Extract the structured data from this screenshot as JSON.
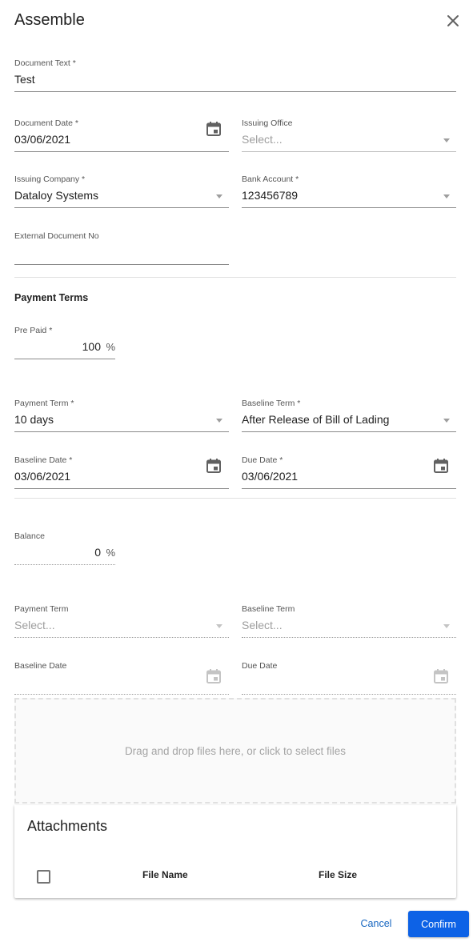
{
  "dialog": {
    "title": "Assemble"
  },
  "fields": {
    "document_text": {
      "label": "Document Text *",
      "value": "Test"
    },
    "document_date": {
      "label": "Document Date *",
      "value": "03/06/2021"
    },
    "issuing_office": {
      "label": "Issuing Office",
      "placeholder": "Select..."
    },
    "issuing_company": {
      "label": "Issuing Company *",
      "value": "Dataloy Systems"
    },
    "bank_account": {
      "label": "Bank Account *",
      "value": "123456789"
    },
    "external_document_no": {
      "label": "External Document No",
      "value": ""
    }
  },
  "payment_terms": {
    "heading": "Payment Terms",
    "pre_paid": {
      "label": "Pre Paid *",
      "value": "100",
      "unit": "%"
    },
    "payment_term": {
      "label": "Payment Term *",
      "value": "10 days"
    },
    "baseline_term": {
      "label": "Baseline Term *",
      "value": "After Release of Bill of Lading"
    },
    "baseline_date": {
      "label": "Baseline Date *",
      "value": "03/06/2021"
    },
    "due_date": {
      "label": "Due Date *",
      "value": "03/06/2021"
    }
  },
  "balance": {
    "balance": {
      "label": "Balance",
      "value": "0",
      "unit": "%"
    },
    "payment_term": {
      "label": "Payment Term",
      "placeholder": "Select..."
    },
    "baseline_term": {
      "label": "Baseline Term",
      "placeholder": "Select..."
    },
    "baseline_date": {
      "label": "Baseline Date",
      "value": ""
    },
    "due_date": {
      "label": "Due Date",
      "value": ""
    }
  },
  "dropzone": {
    "text": "Drag and drop files here, or click to select files"
  },
  "attachments": {
    "title": "Attachments",
    "columns": [
      "File Name",
      "File Size"
    ]
  },
  "actions": {
    "cancel": "Cancel",
    "confirm": "Confirm"
  },
  "colors": {
    "primary": "#0d62e6",
    "link": "#1565c0",
    "divider": "#e0e0e0"
  },
  "icons": {
    "close": "close-icon",
    "calendar": "calendar-icon",
    "dropdown": "chevron-down-icon"
  }
}
